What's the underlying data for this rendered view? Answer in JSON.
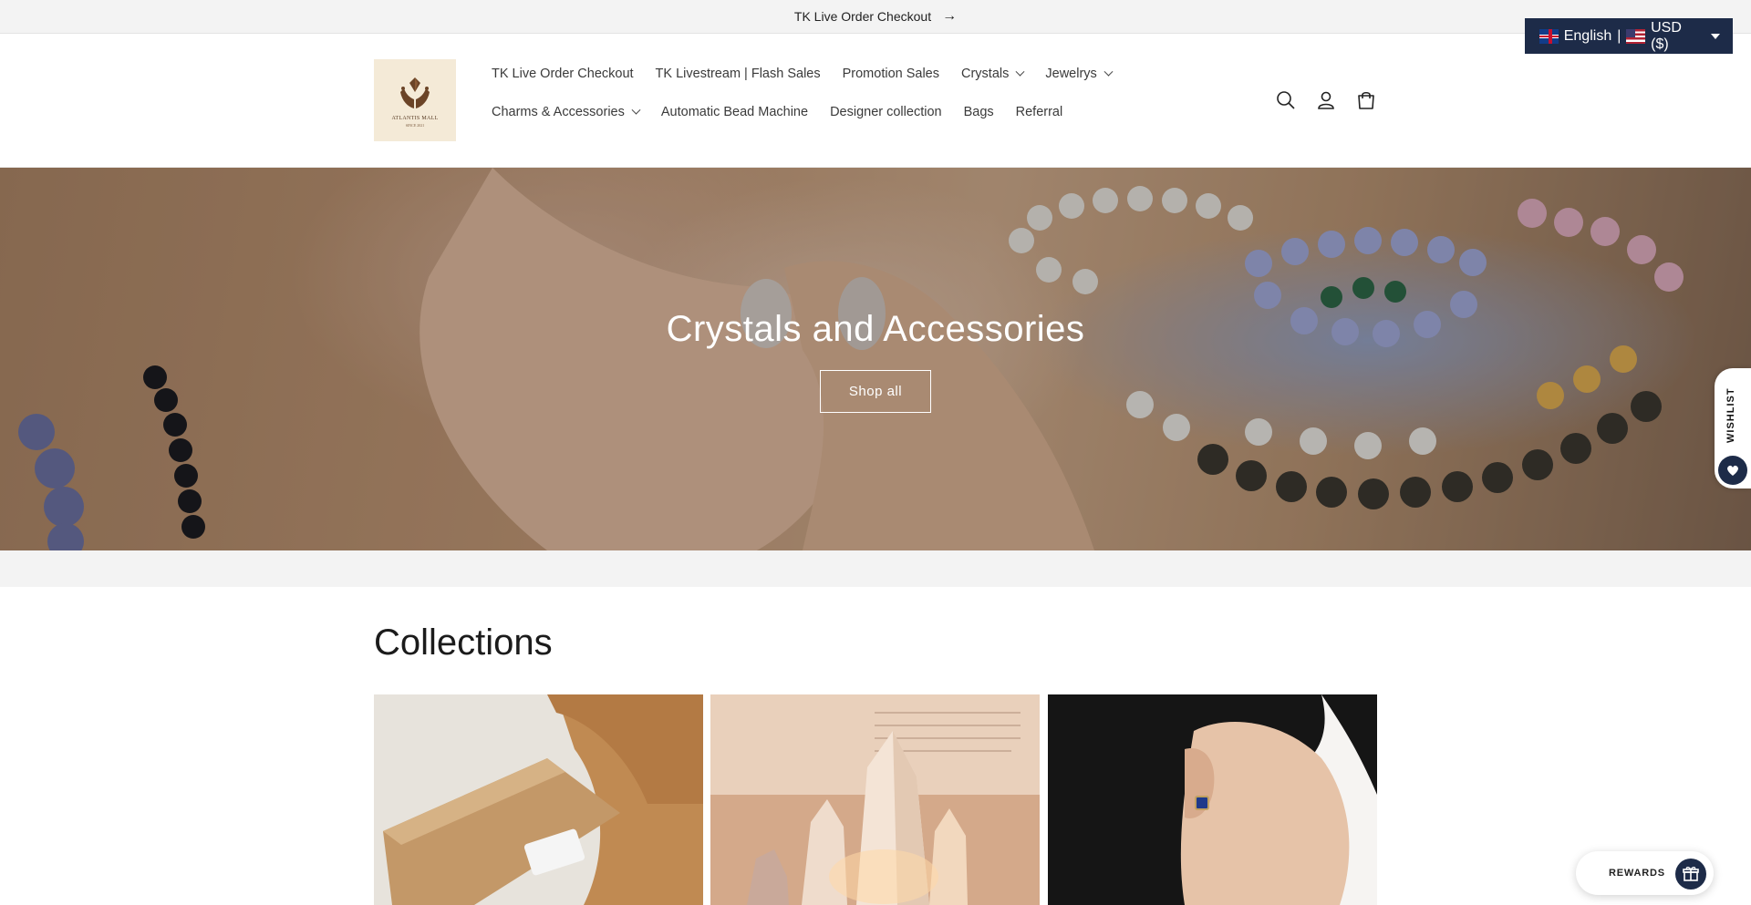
{
  "announcement": {
    "text": "TK Live Order Checkout",
    "arrow": "→"
  },
  "locale": {
    "language": "English",
    "separator": "|",
    "currency": "USD ($)"
  },
  "brand": {
    "logo_text": "ATLANTIS MALL",
    "logo_sub": "SINCE 2021"
  },
  "nav": {
    "row1": [
      {
        "label": "TK Live Order Checkout",
        "dropdown": false
      },
      {
        "label": "TK Livestream | Flash Sales",
        "dropdown": false
      },
      {
        "label": "Promotion Sales",
        "dropdown": false
      },
      {
        "label": "Crystals",
        "dropdown": true
      },
      {
        "label": "Jewelrys",
        "dropdown": true
      }
    ],
    "row2": [
      {
        "label": "Charms & Accessories",
        "dropdown": true
      },
      {
        "label": "Automatic Bead Machine",
        "dropdown": false
      },
      {
        "label": "Designer collection",
        "dropdown": false
      },
      {
        "label": "Bags",
        "dropdown": false
      },
      {
        "label": "Referral",
        "dropdown": false
      }
    ]
  },
  "header_icons": [
    "search-icon",
    "account-icon",
    "cart-icon"
  ],
  "hero": {
    "title": "Crystals and Accessories",
    "button": "Shop all"
  },
  "collections": {
    "title": "Collections"
  },
  "wishlist": {
    "label": "WISHLIST"
  },
  "rewards": {
    "label": "REWARDS"
  },
  "colors": {
    "accent": "#1d2b48",
    "announce_bg": "#f3f3f3",
    "logo_bg": "#f4ead7"
  }
}
